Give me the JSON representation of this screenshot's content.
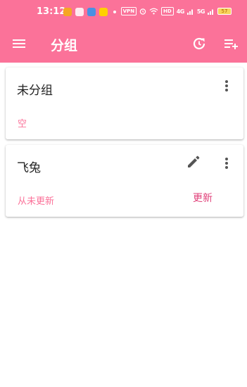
{
  "status_bar": {
    "time": "13:12",
    "vpn": "VPN",
    "network_1": "HD",
    "signal_1": "4G",
    "signal_2": "5G",
    "battery": "57"
  },
  "app_bar": {
    "title": "分组",
    "menu_icon": "menu-icon",
    "refresh_icon": "refresh-icon",
    "add_icon": "playlist-add-icon",
    "color": "#fb7299"
  },
  "groups": [
    {
      "name": "未分组",
      "status": "空"
    },
    {
      "name": "飞兔",
      "status": "从未更新",
      "update_label": "更新"
    }
  ]
}
